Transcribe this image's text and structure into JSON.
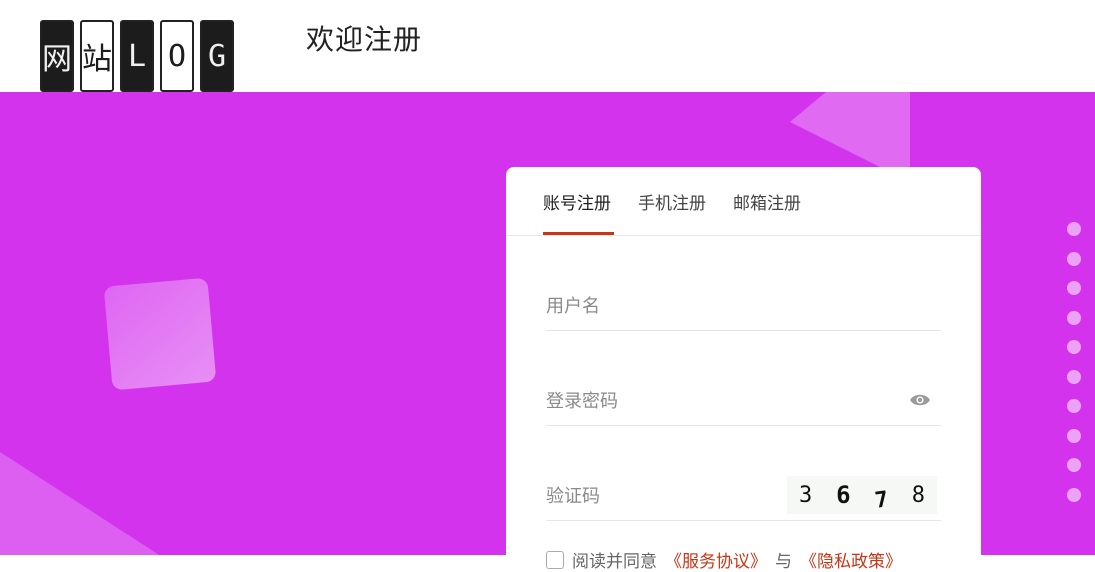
{
  "header": {
    "logo_chars": [
      "网",
      "站",
      "L",
      "O",
      "G"
    ],
    "title": "欢迎注册"
  },
  "card": {
    "tabs": [
      {
        "label": "账号注册",
        "active": true
      },
      {
        "label": "手机注册",
        "active": false
      },
      {
        "label": "邮箱注册",
        "active": false
      }
    ],
    "fields": {
      "username_placeholder": "用户名",
      "password_placeholder": "登录密码",
      "captcha_placeholder": "验证码",
      "captcha_digits": [
        "3",
        "6",
        "7",
        "8"
      ]
    },
    "agreement": {
      "prefix": "阅读并同意",
      "terms_link": "《服务协议》",
      "and": "与",
      "privacy_link": "《隐私政策》"
    }
  },
  "colors": {
    "hero_bg": "#d433ee",
    "accent": "#c93415"
  },
  "icons": {
    "password_toggle": "eye-icon"
  }
}
